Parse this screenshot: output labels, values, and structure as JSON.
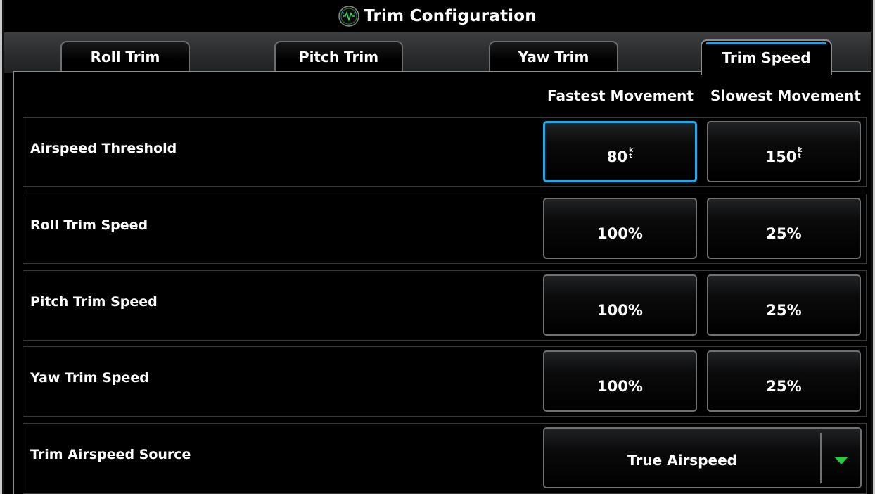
{
  "window": {
    "title": "Trim Configuration",
    "icon": "trim-app-icon"
  },
  "tabs": [
    {
      "label": "Roll Trim",
      "active": false
    },
    {
      "label": "Pitch Trim",
      "active": false
    },
    {
      "label": "Yaw Trim",
      "active": false
    },
    {
      "label": "Trim Speed",
      "active": true
    }
  ],
  "columns": {
    "fastest": "Fastest Movement",
    "slowest": "Slowest Movement"
  },
  "rows": [
    {
      "label": "Airspeed Threshold",
      "fastest": "80",
      "slowest": "150",
      "unit_top": "k",
      "unit_bottom": "t"
    },
    {
      "label": "Roll Trim Speed",
      "fastest": "100%",
      "slowest": "25%"
    },
    {
      "label": "Pitch Trim Speed",
      "fastest": "100%",
      "slowest": "25%"
    },
    {
      "label": "Yaw Trim Speed",
      "fastest": "100%",
      "slowest": "25%"
    }
  ],
  "source": {
    "label": "Trim Airspeed Source",
    "value": "True Airspeed",
    "arrow_icon": "dropdown-arrow-icon"
  },
  "colors": {
    "accent": "#1fa9e6",
    "arrow": "#1fd038",
    "tab_highlight": "#2f9fdc"
  }
}
